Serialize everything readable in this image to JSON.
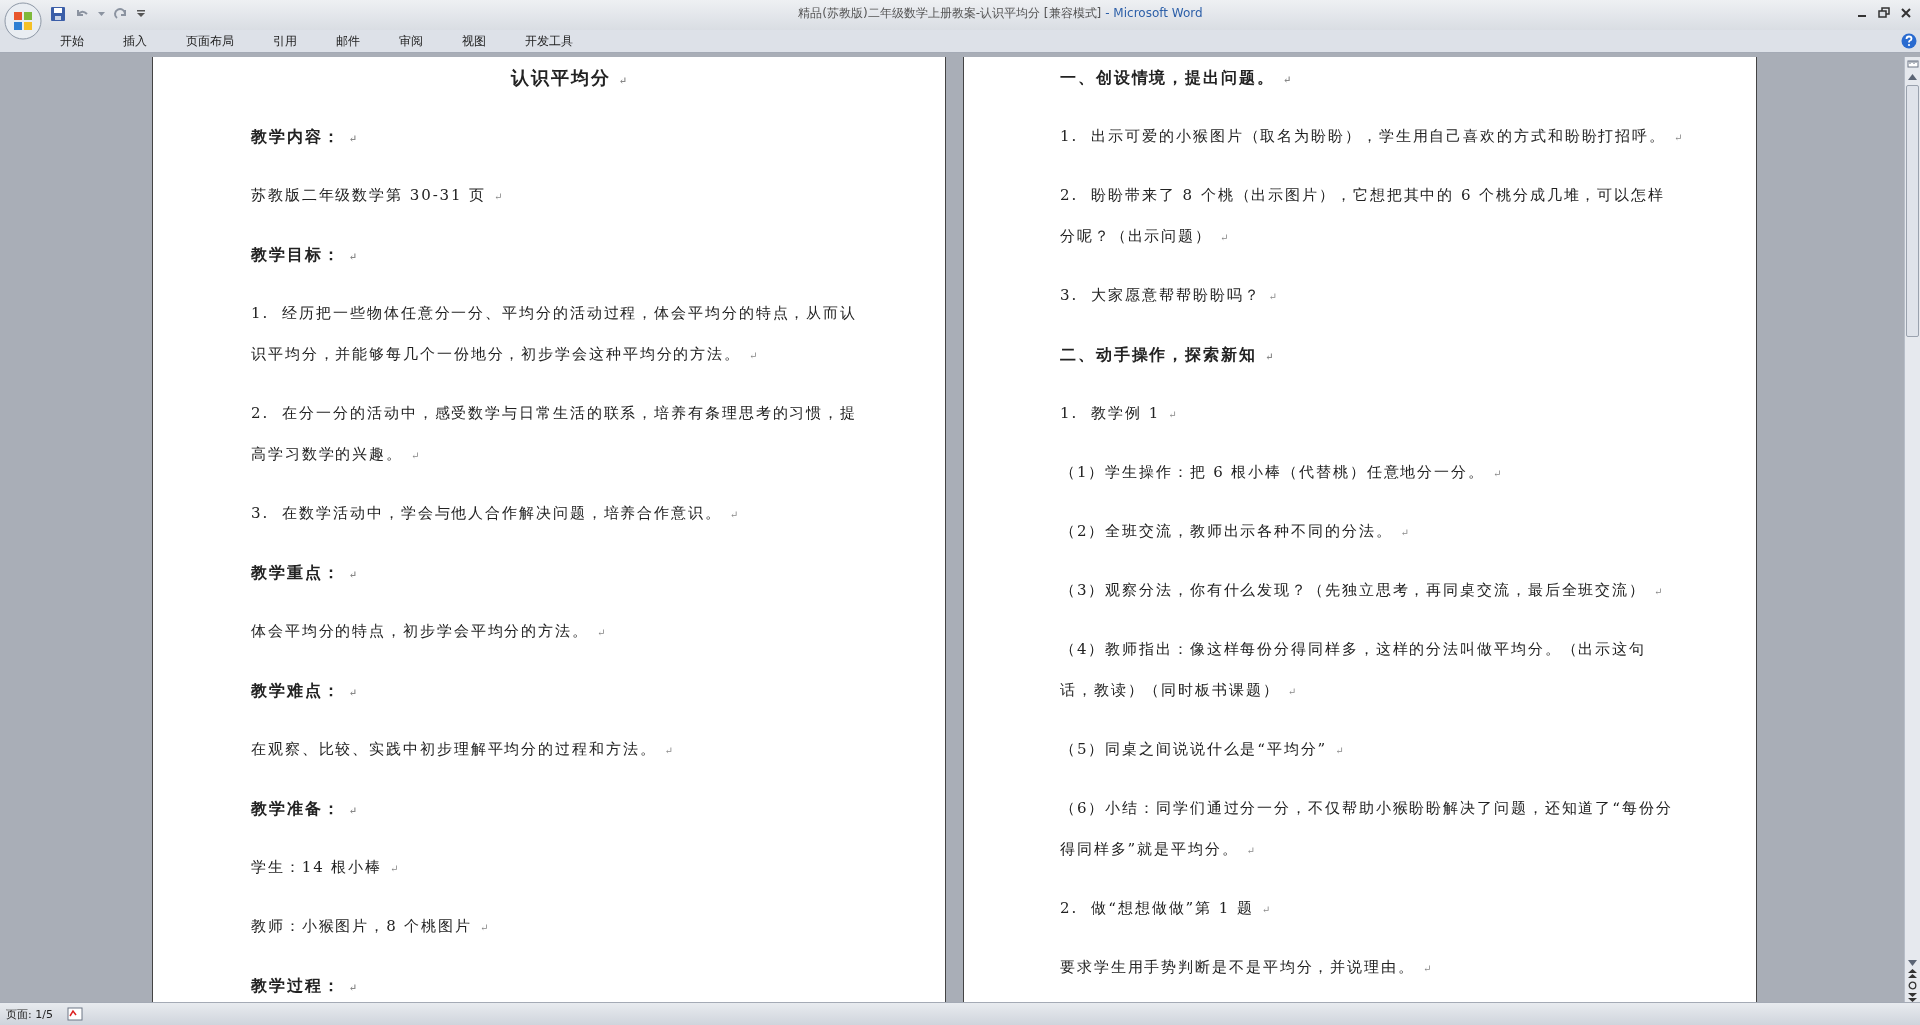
{
  "window": {
    "title": "精品(苏教版)二年级数学上册教案-认识平均分 [兼容模式]",
    "app": "- Microsoft Word"
  },
  "ribbon_tabs": [
    {
      "label": "开始"
    },
    {
      "label": "插入"
    },
    {
      "label": "页面布局"
    },
    {
      "label": "引用"
    },
    {
      "label": "邮件"
    },
    {
      "label": "审阅"
    },
    {
      "label": "视图"
    },
    {
      "label": "开发工具"
    }
  ],
  "pages": [
    {
      "paragraphs": [
        {
          "kind": "title",
          "text": "认识平均分",
          "mark": "↵"
        },
        {
          "kind": "heading",
          "text": "教学内容：",
          "mark": "↵"
        },
        {
          "kind": "body",
          "text": "苏教版二年级数学第 30-31 页",
          "mark": "↵"
        },
        {
          "kind": "heading",
          "text": "教学目标：",
          "mark": "↵"
        },
        {
          "kind": "body",
          "text": "1.  经历把一些物体任意分一分、平均分的活动过程，体会平均分的特点，从而认识平均分，并能够每几个一份地分，初步学会这种平均分的方法。",
          "mark": "↵"
        },
        {
          "kind": "body",
          "text": "2.  在分一分的活动中，感受数学与日常生活的联系，培养有条理思考的习惯，提高学习数学的兴趣。",
          "mark": "↵"
        },
        {
          "kind": "body",
          "text": "3.  在数学活动中，学会与他人合作解决问题，培养合作意识。",
          "mark": "↵"
        },
        {
          "kind": "heading",
          "text": "教学重点：",
          "mark": "↵"
        },
        {
          "kind": "body",
          "text": "体会平均分的特点，初步学会平均分的方法。",
          "mark": "↵"
        },
        {
          "kind": "heading",
          "text": "教学难点：",
          "mark": "↵"
        },
        {
          "kind": "body",
          "text": "在观察、比较、实践中初步理解平均分的过程和方法。",
          "mark": "↵"
        },
        {
          "kind": "heading",
          "text": "教学准备：",
          "mark": "↵"
        },
        {
          "kind": "body",
          "text": "学生：14 根小棒",
          "mark": "↵"
        },
        {
          "kind": "body",
          "text": "教师：小猴图片，8 个桃图片",
          "mark": "↵"
        },
        {
          "kind": "heading",
          "text": "教学过程：",
          "mark": "↵"
        }
      ]
    },
    {
      "paragraphs": [
        {
          "kind": "heading",
          "text": "一、创设情境，提出问题。",
          "mark": "↵"
        },
        {
          "kind": "body",
          "text": "1.  出示可爱的小猴图片（取名为盼盼），学生用自己喜欢的方式和盼盼打招呼。",
          "mark": "↵"
        },
        {
          "kind": "body",
          "text": "2.  盼盼带来了 8 个桃（出示图片），它想把其中的 6 个桃分成几堆，可以怎样分呢？（出示问题）",
          "mark": "↵"
        },
        {
          "kind": "body",
          "text": "3.  大家愿意帮帮盼盼吗？",
          "mark": "↵"
        },
        {
          "kind": "heading",
          "text": "二、动手操作，探索新知",
          "mark": "↵"
        },
        {
          "kind": "body",
          "text": "1.  教学例 1",
          "mark": "↵"
        },
        {
          "kind": "body",
          "text": "（1）学生操作：把 6 根小棒（代替桃）任意地分一分。",
          "mark": "↵"
        },
        {
          "kind": "body",
          "text": "（2）全班交流，教师出示各种不同的分法。",
          "mark": "↵"
        },
        {
          "kind": "body",
          "text": "（3）观察分法，你有什么发现？（先独立思考，再同桌交流，最后全班交流）",
          "mark": "↵"
        },
        {
          "kind": "body",
          "text": "（4）教师指出：像这样每份分得同样多，这样的分法叫做平均分。（出示这句话，教读）（同时板书课题）",
          "mark": "↵"
        },
        {
          "kind": "body",
          "text": "（5）同桌之间说说什么是“平均分”",
          "mark": "↵"
        },
        {
          "kind": "body",
          "text": "（6）小结：同学们通过分一分，不仅帮助小猴盼盼解决了问题，还知道了“每份分得同样多”就是平均分。",
          "mark": "↵"
        },
        {
          "kind": "body",
          "text": "2.  做“想想做做”第 1 题",
          "mark": "↵"
        },
        {
          "kind": "body",
          "text": "要求学生用手势判断是不是平均分，并说理由。",
          "mark": "↵"
        }
      ]
    }
  ],
  "status_bar": {
    "page": "页面: 1/5"
  }
}
